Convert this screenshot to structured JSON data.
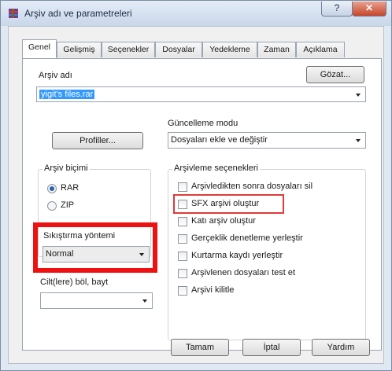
{
  "window": {
    "title": "Arşiv adı ve parametreleri",
    "help_label": "?",
    "close_label": "✕"
  },
  "tabs": [
    {
      "label": "Genel",
      "active": true
    },
    {
      "label": "Gelişmiş"
    },
    {
      "label": "Seçenekler"
    },
    {
      "label": "Dosyalar"
    },
    {
      "label": "Yedekleme"
    },
    {
      "label": "Zaman"
    },
    {
      "label": "Açıklama"
    }
  ],
  "general": {
    "archive_name_label": "Arşiv adı",
    "browse_label": "Gözat...",
    "archive_name_value": "yigit's files.rar",
    "profiles_label": "Profiller...",
    "update_mode_label": "Güncelleme modu",
    "update_mode_value": "Dosyaları ekle ve değiştir",
    "archive_format": {
      "title": "Arşiv biçimi",
      "options": [
        "RAR",
        "ZIP"
      ],
      "selected": "RAR"
    },
    "compression_method": {
      "label": "Sıkıştırma yöntemi",
      "value": "Normal"
    },
    "split_label": "Cilt(lere) böl, bayt",
    "split_value": "",
    "archiving_options": {
      "title": "Arşivleme seçenekleri",
      "items": [
        {
          "label": "Arşivledikten sonra dosyaları sil",
          "checked": false
        },
        {
          "label": "SFX arşivi oluştur",
          "checked": false
        },
        {
          "label": "Katı arşiv oluştur",
          "checked": false
        },
        {
          "label": "Gerçeklik denetleme yerleştir",
          "checked": false
        },
        {
          "label": "Kurtarma kaydı yerleştir",
          "checked": false
        },
        {
          "label": "Arşivlenen dosyaları test et",
          "checked": false
        },
        {
          "label": "Arşivi kilitle",
          "checked": false
        }
      ]
    }
  },
  "buttons": {
    "ok_label": "Tamam",
    "cancel_label": "İptal",
    "help_label": "Yardım"
  },
  "colors": {
    "highlight_thick": "#ee1111",
    "highlight_thin": "#e03a3a",
    "selection": "#3399ff"
  }
}
